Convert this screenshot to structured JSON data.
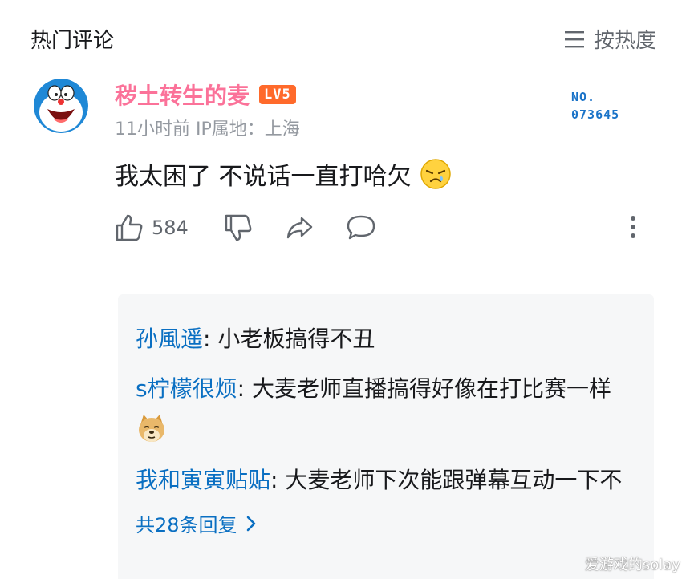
{
  "header": {
    "title": "热门评论",
    "sort_label": "按热度",
    "sort_icon": "menu-lines-icon"
  },
  "comment": {
    "avatar_icon": "doraemon-avatar",
    "username": "秽土转生的麦",
    "level": "LV5",
    "meta": "11小时前  IP属地：上海",
    "nft_label": "NO.",
    "nft_number": "073645",
    "text": "我太困了 不说话一直打哈欠",
    "emoji": "sleepy-face-emoji",
    "like_count": "584"
  },
  "replies": [
    {
      "name": "孙風遥",
      "sep": ": ",
      "text": "小老板搞得不丑"
    },
    {
      "name": "s柠檬很烦",
      "sep": ": ",
      "text": "大麦老师直播搞得好像在打比赛一样",
      "emoji": "doge-emoji"
    },
    {
      "name": "我和寅寅贴贴",
      "sep": ": ",
      "text": "大麦老师下次能跟弹幕互动一下不"
    }
  ],
  "reply_total": "共28条回复",
  "watermark": "爱游戏的solay"
}
